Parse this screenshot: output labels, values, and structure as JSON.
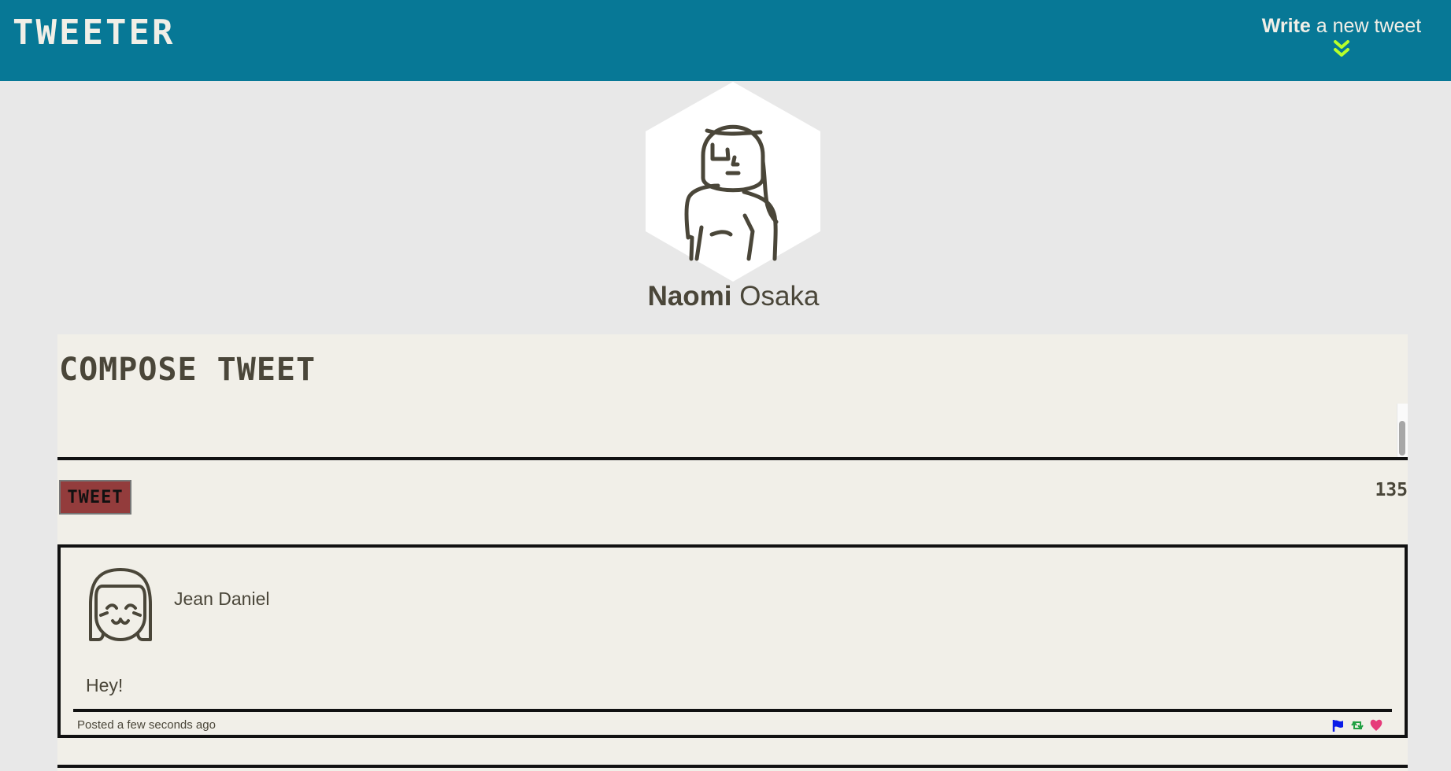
{
  "app": {
    "brand": "TWEETER"
  },
  "nav": {
    "write_bold": "Write",
    "write_rest": " a new tweet"
  },
  "profile": {
    "first_name": "Naomi",
    "last_name": " Osaka"
  },
  "compose": {
    "title": "COMPOSE TWEET",
    "text": "",
    "button_label": "TWEET",
    "counter": "135"
  },
  "tweets": [
    {
      "author": "Jean Daniel",
      "text": "Hey!",
      "posted": "Posted a few seconds ago"
    }
  ],
  "colors": {
    "topbar": "#077896",
    "page_bg": "#e8e8e8",
    "content_bg": "#f1efe8",
    "button_bg": "#933c3c",
    "accent": "#b7ff2b",
    "flag": "#0a1ce8",
    "retweet": "#21a043",
    "heart": "#e63b7a"
  },
  "icons": [
    "chevron-double-down-icon",
    "user-avatar-woman-icon",
    "user-avatar-girl-icon",
    "flag-icon",
    "retweet-icon",
    "heart-icon"
  ]
}
